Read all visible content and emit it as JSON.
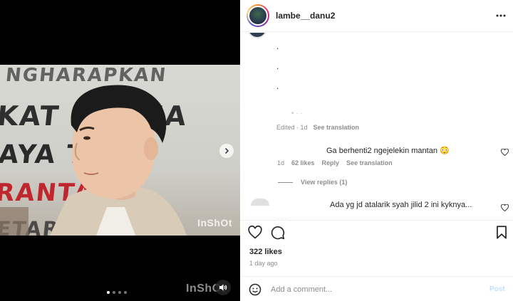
{
  "media": {
    "banner_lines": [
      "NGHARAPKAN",
      "KAT PE     KEA",
      "AYA TE      P",
      "RANTARA",
      "ETAR"
    ],
    "watermark": "InShOt",
    "video_watermark": "InShOt",
    "carousel_dots": 4,
    "active_dot": 0,
    "icons": {
      "next": "chevron-right-icon",
      "sound": "speaker-icon"
    }
  },
  "post": {
    "username": "lambe__danu2",
    "likes": "322 likes",
    "time": "1 day ago"
  },
  "comments": {
    "first": {
      "periods": [
        ".",
        ".",
        "."
      ],
      "meta": {
        "time": "Edited · 1d",
        "see_translation": "See translation"
      }
    },
    "second": {
      "text": "Ga berhenti2 ngejelekin mantan 😳",
      "time": "1d",
      "likes": "62 likes",
      "reply": "Reply",
      "see_translation": "See translation"
    },
    "view_replies": "View replies (1)",
    "third": {
      "text": "Ada yg jd atalarik syah jilid 2 ini kyknya..."
    }
  },
  "add_comment": {
    "placeholder": "Add a comment...",
    "post_label": "Post"
  },
  "colors": {
    "link_blue": "#0095f6",
    "post_disabled": "#c0dffd",
    "muted": "#8e8e8e",
    "banner_red": "#c0262d"
  }
}
